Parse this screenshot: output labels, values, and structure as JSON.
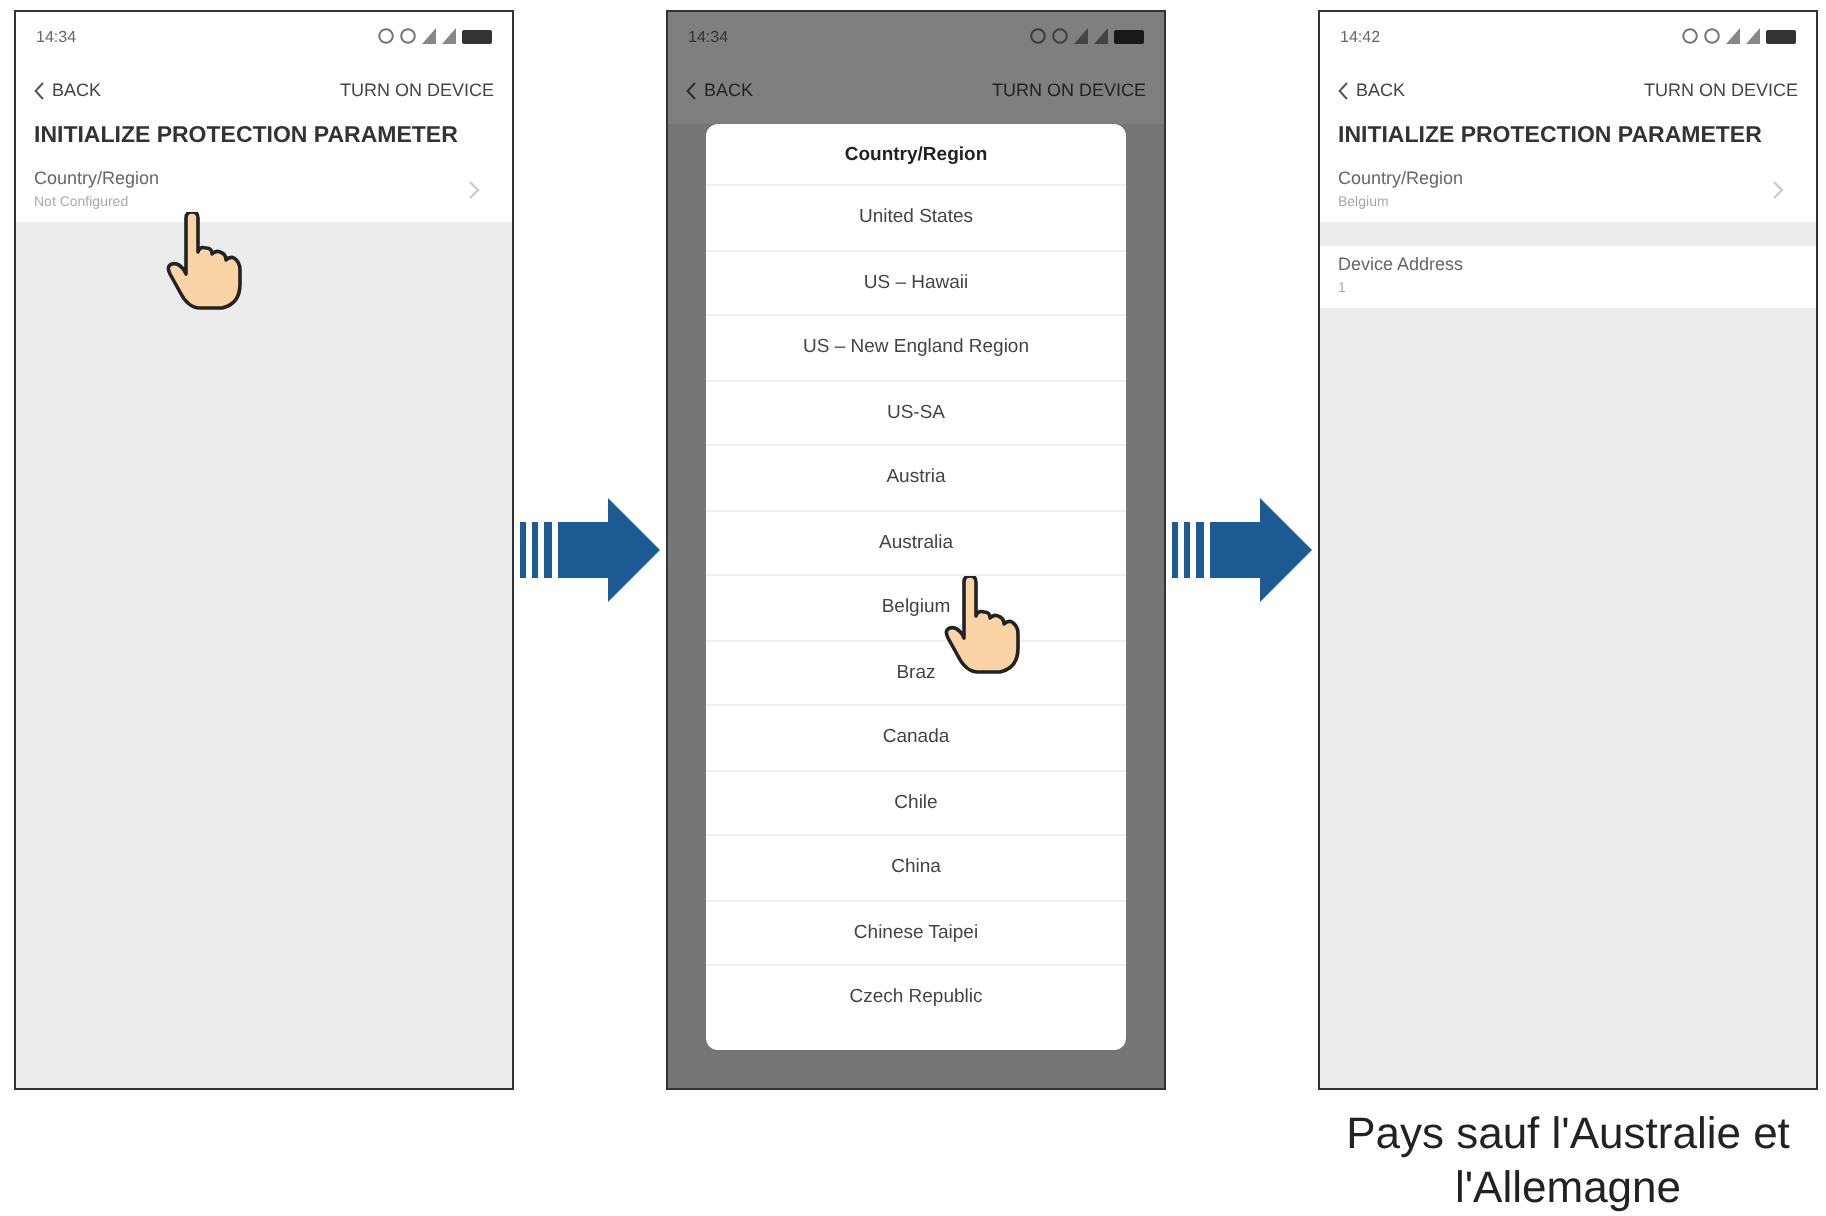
{
  "screens": [
    {
      "time": "14:34",
      "back": "BACK",
      "action": "TURN ON DEVICE",
      "title": "INITIALIZE PROTECTION PARAMETER",
      "hand": true,
      "items": [
        {
          "label": "Country/Region",
          "value": "Not Configured",
          "chevron": true
        }
      ]
    },
    {
      "time": "14:34",
      "back": "BACK",
      "action": "TURN ON DEVICE",
      "hand": true,
      "dialog": {
        "title": "Country/Region",
        "options": [
          "United States",
          "US – Hawaii",
          "US – New England Region",
          "US-SA",
          "Austria",
          "Australia",
          "Belgium",
          "Braz",
          "Canada",
          "Chile",
          "China",
          "Chinese Taipei",
          "Czech Republic"
        ]
      }
    },
    {
      "time": "14:42",
      "back": "BACK",
      "action": "TURN ON DEVICE",
      "title": "INITIALIZE PROTECTION PARAMETER",
      "hand": false,
      "items": [
        {
          "label": "Country/Region",
          "value": "Belgium",
          "chevron": true
        },
        {
          "label": "Device Address",
          "value": "1",
          "chevron": false
        }
      ]
    }
  ],
  "caption": "Pays sauf l'Australie et l'Allemagne"
}
